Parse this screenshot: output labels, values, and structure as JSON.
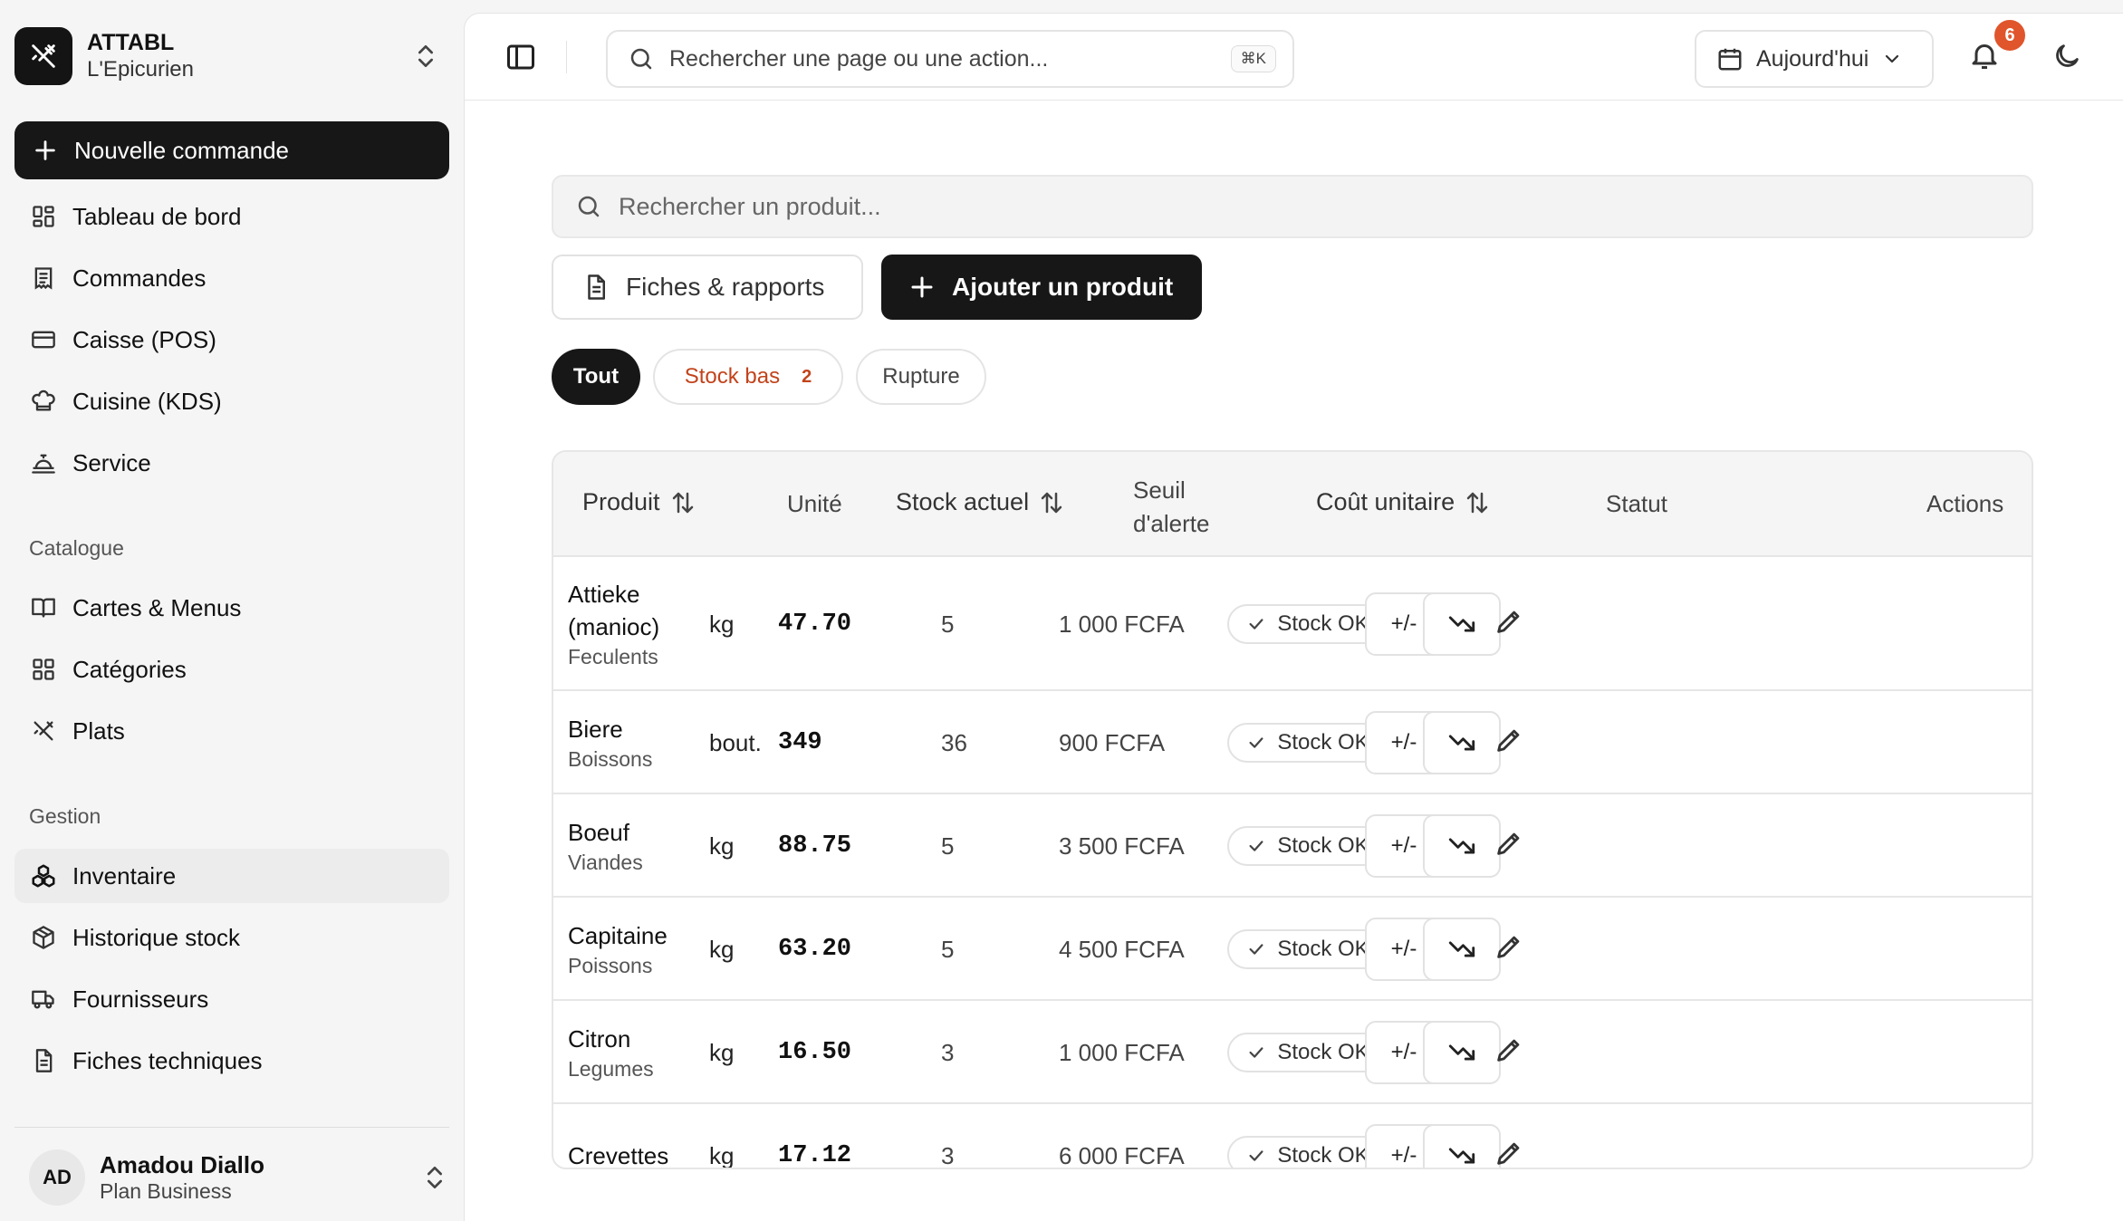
{
  "brand": {
    "name": "ATTABL",
    "subtitle": "L'Epicurien"
  },
  "sidebar": {
    "new_order": "Nouvelle commande",
    "main_items": [
      {
        "label": "Tableau de bord",
        "icon": "dashboard-icon"
      },
      {
        "label": "Commandes",
        "icon": "receipt-icon"
      },
      {
        "label": "Caisse (POS)",
        "icon": "credit-card-icon"
      },
      {
        "label": "Cuisine (KDS)",
        "icon": "chef-hat-icon"
      },
      {
        "label": "Service",
        "icon": "cloche-icon"
      }
    ],
    "catalogue_title": "Catalogue",
    "catalogue_items": [
      {
        "label": "Cartes & Menus",
        "icon": "book-open-icon"
      },
      {
        "label": "Catégories",
        "icon": "grid-icon"
      },
      {
        "label": "Plats",
        "icon": "utensils-icon"
      }
    ],
    "gestion_title": "Gestion",
    "gestion_items": [
      {
        "label": "Inventaire",
        "icon": "boxes-icon",
        "active": true
      },
      {
        "label": "Historique stock",
        "icon": "package-icon"
      },
      {
        "label": "Fournisseurs",
        "icon": "truck-icon"
      },
      {
        "label": "Fiches techniques",
        "icon": "file-text-icon"
      }
    ]
  },
  "user": {
    "initials": "AD",
    "name": "Amadou Diallo",
    "plan": "Plan Business"
  },
  "topbar": {
    "search_placeholder": "Rechercher une page ou une action...",
    "shortcut": "⌘K",
    "date_label": "Aujourd'hui",
    "notifications_count": "6"
  },
  "inventory": {
    "search_placeholder": "Rechercher un produit...",
    "reports_button": "Fiches & rapports",
    "add_button": "Ajouter un produit",
    "filters": {
      "all": "Tout",
      "low": "Stock bas",
      "low_count": "2",
      "out": "Rupture"
    },
    "columns": {
      "product": "Produit",
      "unit": "Unité",
      "stock": "Stock actuel",
      "threshold_1": "Seuil",
      "threshold_2": "d'alerte",
      "cost": "Coût unitaire",
      "status": "Statut",
      "actions": "Actions"
    },
    "adjust_label": "+/-",
    "rows": [
      {
        "name_1": "Attieke",
        "name_2": "(manioc)",
        "category": "Feculents",
        "unit": "kg",
        "stock": "47.70",
        "threshold": "5",
        "cost": "1 000 FCFA",
        "status": "Stock OK"
      },
      {
        "name_1": "Biere",
        "name_2": "",
        "category": "Boissons",
        "unit": "bout.",
        "stock": "349",
        "threshold": "36",
        "cost": "900 FCFA",
        "status": "Stock OK"
      },
      {
        "name_1": "Boeuf",
        "name_2": "",
        "category": "Viandes",
        "unit": "kg",
        "stock": "88.75",
        "threshold": "5",
        "cost": "3 500 FCFA",
        "status": "Stock OK"
      },
      {
        "name_1": "Capitaine",
        "name_2": "",
        "category": "Poissons",
        "unit": "kg",
        "stock": "63.20",
        "threshold": "5",
        "cost": "4 500 FCFA",
        "status": "Stock OK"
      },
      {
        "name_1": "Citron",
        "name_2": "",
        "category": "Legumes",
        "unit": "kg",
        "stock": "16.50",
        "threshold": "3",
        "cost": "1 000 FCFA",
        "status": "Stock OK"
      },
      {
        "name_1": "Crevettes",
        "name_2": "",
        "category": "",
        "unit": "kg",
        "stock": "17.12",
        "threshold": "3",
        "cost": "6 000 FCFA",
        "status": "Stock OK"
      }
    ]
  }
}
